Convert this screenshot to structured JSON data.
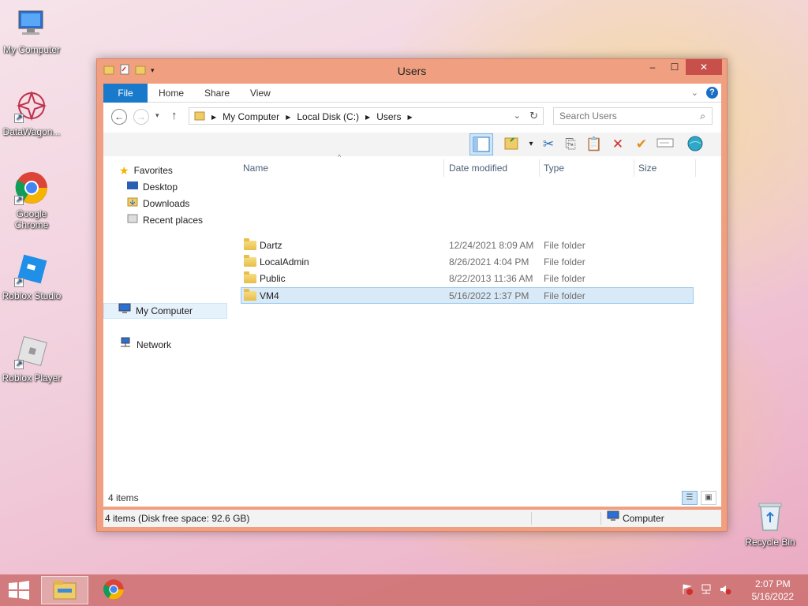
{
  "desktop": {
    "icons": [
      {
        "label": "My Computer"
      },
      {
        "label": "DataWagon..."
      },
      {
        "label": "Google Chrome"
      },
      {
        "label": "Roblox Studio"
      },
      {
        "label": "Roblox Player"
      },
      {
        "label": "Recycle Bin"
      }
    ]
  },
  "window": {
    "title": "Users",
    "controls": {
      "minimize": "–",
      "maximize": "☐",
      "close": "✕"
    },
    "tabs": [
      {
        "label": "File"
      },
      {
        "label": "Home"
      },
      {
        "label": "Share"
      },
      {
        "label": "View"
      }
    ],
    "address": {
      "crumbs": [
        "My Computer",
        "Local Disk (C:)",
        "Users"
      ]
    },
    "search": {
      "placeholder": "Search Users"
    },
    "navpane": {
      "favorites": "Favorites",
      "items": [
        "Desktop",
        "Downloads",
        "Recent places"
      ],
      "computer": "My Computer",
      "network": "Network"
    },
    "columns": [
      "Name",
      "Date modified",
      "Type",
      "Size"
    ],
    "files": [
      {
        "name": "Dartz",
        "date": "12/24/2021 8:09 AM",
        "type": "File folder"
      },
      {
        "name": "LocalAdmin",
        "date": "8/26/2021 4:04 PM",
        "type": "File folder"
      },
      {
        "name": "Public",
        "date": "8/22/2013 11:36 AM",
        "type": "File folder"
      },
      {
        "name": "VM4",
        "date": "5/16/2022 1:37 PM",
        "type": "File folder"
      }
    ],
    "item_count": "4 items",
    "status": {
      "left": "4 items (Disk free space: 92.6 GB)",
      "right": "Computer"
    }
  },
  "taskbar": {
    "time": "2:07 PM",
    "date": "5/16/2022"
  },
  "colors": {
    "window_frame": "#f0a080",
    "file_tab": "#1979ca",
    "selection": "#d8eaf8",
    "taskbar": "#cd6e6e"
  }
}
